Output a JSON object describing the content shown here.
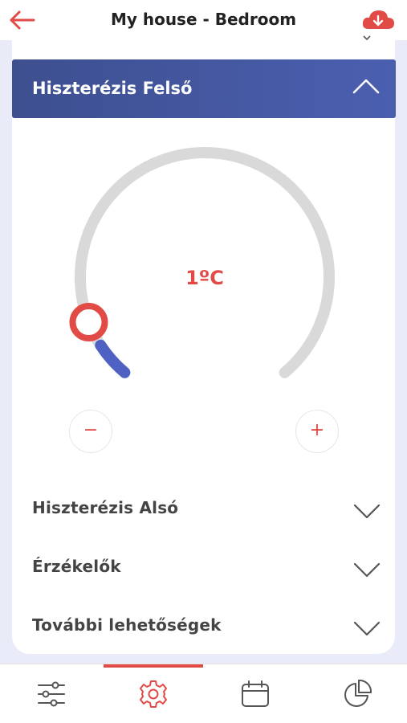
{
  "header": {
    "title": "My house - Bedroom",
    "back_icon": "arrow-left-icon",
    "cloud_icon": "cloud-download-icon"
  },
  "section": {
    "title": "Hiszterézis Felső",
    "expanded": true
  },
  "dial": {
    "value_label": "1ºC",
    "value": 1,
    "fraction": 0.06,
    "min_label": "−",
    "plus_label": "+"
  },
  "accordion": [
    {
      "label": "Hiszterézis Alsó"
    },
    {
      "label": "Érzékelők"
    },
    {
      "label": "További lehetőségek"
    }
  ],
  "tabs": [
    {
      "icon": "sliders-icon",
      "active": false
    },
    {
      "icon": "gear-icon",
      "active": true
    },
    {
      "icon": "calendar-icon",
      "active": false
    },
    {
      "icon": "pie-chart-icon",
      "active": false
    }
  ],
  "colors": {
    "accent": "#e24a45",
    "header_blue": "#4457a3",
    "progress": "#4f62c4",
    "track": "#d9d9d9",
    "background": "#e9ecf8"
  }
}
